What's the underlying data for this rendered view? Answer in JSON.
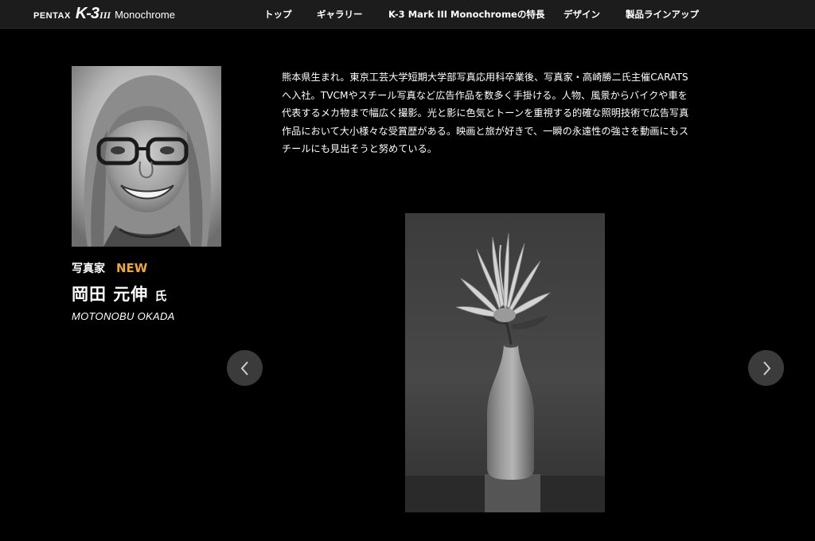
{
  "brand": {
    "maker": "PENTAX",
    "model": "K-3",
    "model_suffix": "III",
    "edition": "Monochrome"
  },
  "nav": {
    "items": [
      {
        "label": "トップ"
      },
      {
        "label": "ギャラリー"
      },
      {
        "label": "K-3 Mark III Monochromeの特長"
      },
      {
        "label": "デザイン"
      },
      {
        "label": "製品ラインアップ"
      }
    ]
  },
  "profile": {
    "role": "写真家",
    "badge": "NEW",
    "name": "岡田 元伸",
    "honorific": "氏",
    "name_romaji": "MOTONOBU OKADA"
  },
  "bio": {
    "lines": [
      "熊本県生まれ。東京工芸大学短期大学部写真応用科卒業後、写真家・高崎勝二氏主催CARATS",
      "へ入社。TVCMやスチール写真など広告作品を数多く手掛ける。人物、風景からバイクや車を",
      "代表するメカ物まで幅広く撮影。光と影に色気とトーンを重視する的確な照明技術で広告写真",
      "作品において大小様々な受賞歴がある。映画と旅が好きで、一瞬の永遠性の強さを動画にもス",
      "チールにも見出そうと努めている。"
    ]
  },
  "gallery": {
    "prev_icon": "chevron-left-icon",
    "next_icon": "chevron-right-icon"
  },
  "colors": {
    "background": "#000000",
    "header": "#1c1c1c",
    "accent_new": "#f0a82a",
    "arrow_bg": "#3b3b3b"
  }
}
